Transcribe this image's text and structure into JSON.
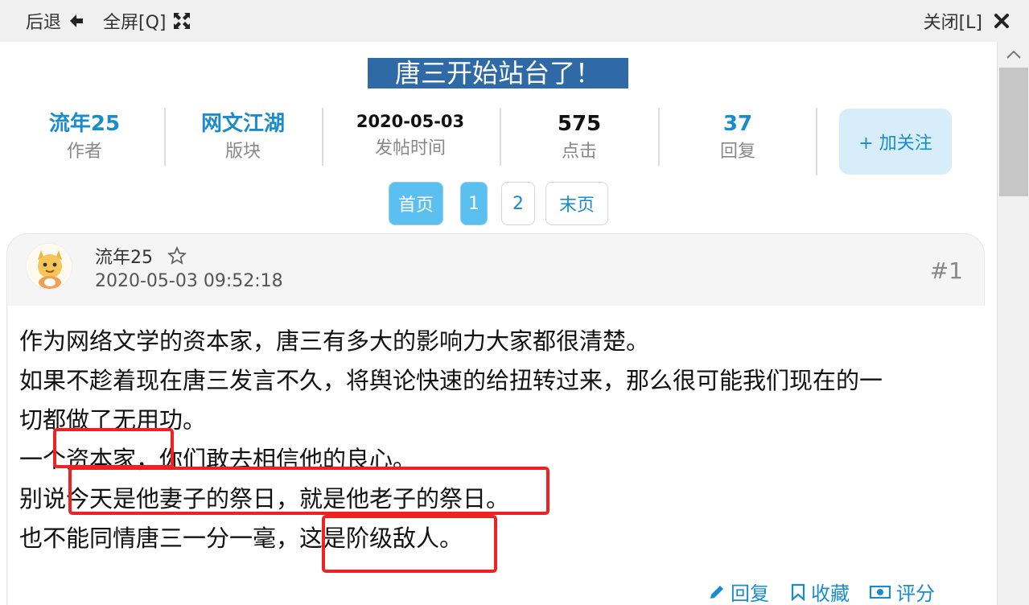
{
  "topbar": {
    "back_label": "后退",
    "fullscreen_label": "全屏[Q]",
    "close_label": "关闭[L]"
  },
  "thread": {
    "title": "唐三开始站台了！",
    "author_value": "流年25",
    "author_label": "作者",
    "board_value": "网文江湖",
    "board_label": "版块",
    "date_value": "2020-05-03",
    "date_label": "发帖时间",
    "views_value": "575",
    "views_label": "点击",
    "replies_value": "37",
    "replies_label": "回复",
    "follow_label": "+ 加关注"
  },
  "pagination": {
    "first": "首页",
    "pages": [
      "1",
      "2"
    ],
    "last": "末页"
  },
  "post": {
    "author": "流年25",
    "time": "2020-05-03 09:52:18",
    "floor": "#1",
    "lines": [
      "作为网络文学的资本家，唐三有多大的影响力大家都很清楚。",
      "如果不趁着现在唐三发言不久，将舆论快速的给扭转过来，那么很可能我们现在的一",
      "切都做了无用功。",
      "一个资本家，你们敢去相信他的良心。",
      "别说今天是他妻子的祭日，就是他老子的祭日。",
      "也不能同情唐三一分一毫，这是阶级敌人。"
    ],
    "actions": {
      "reply": "回复",
      "favorite": "收藏",
      "rate": "评分"
    }
  },
  "colors": {
    "accent": "#1a8ccc",
    "title_bg": "#2f6aa6",
    "highlight_box": "#ee2222"
  }
}
